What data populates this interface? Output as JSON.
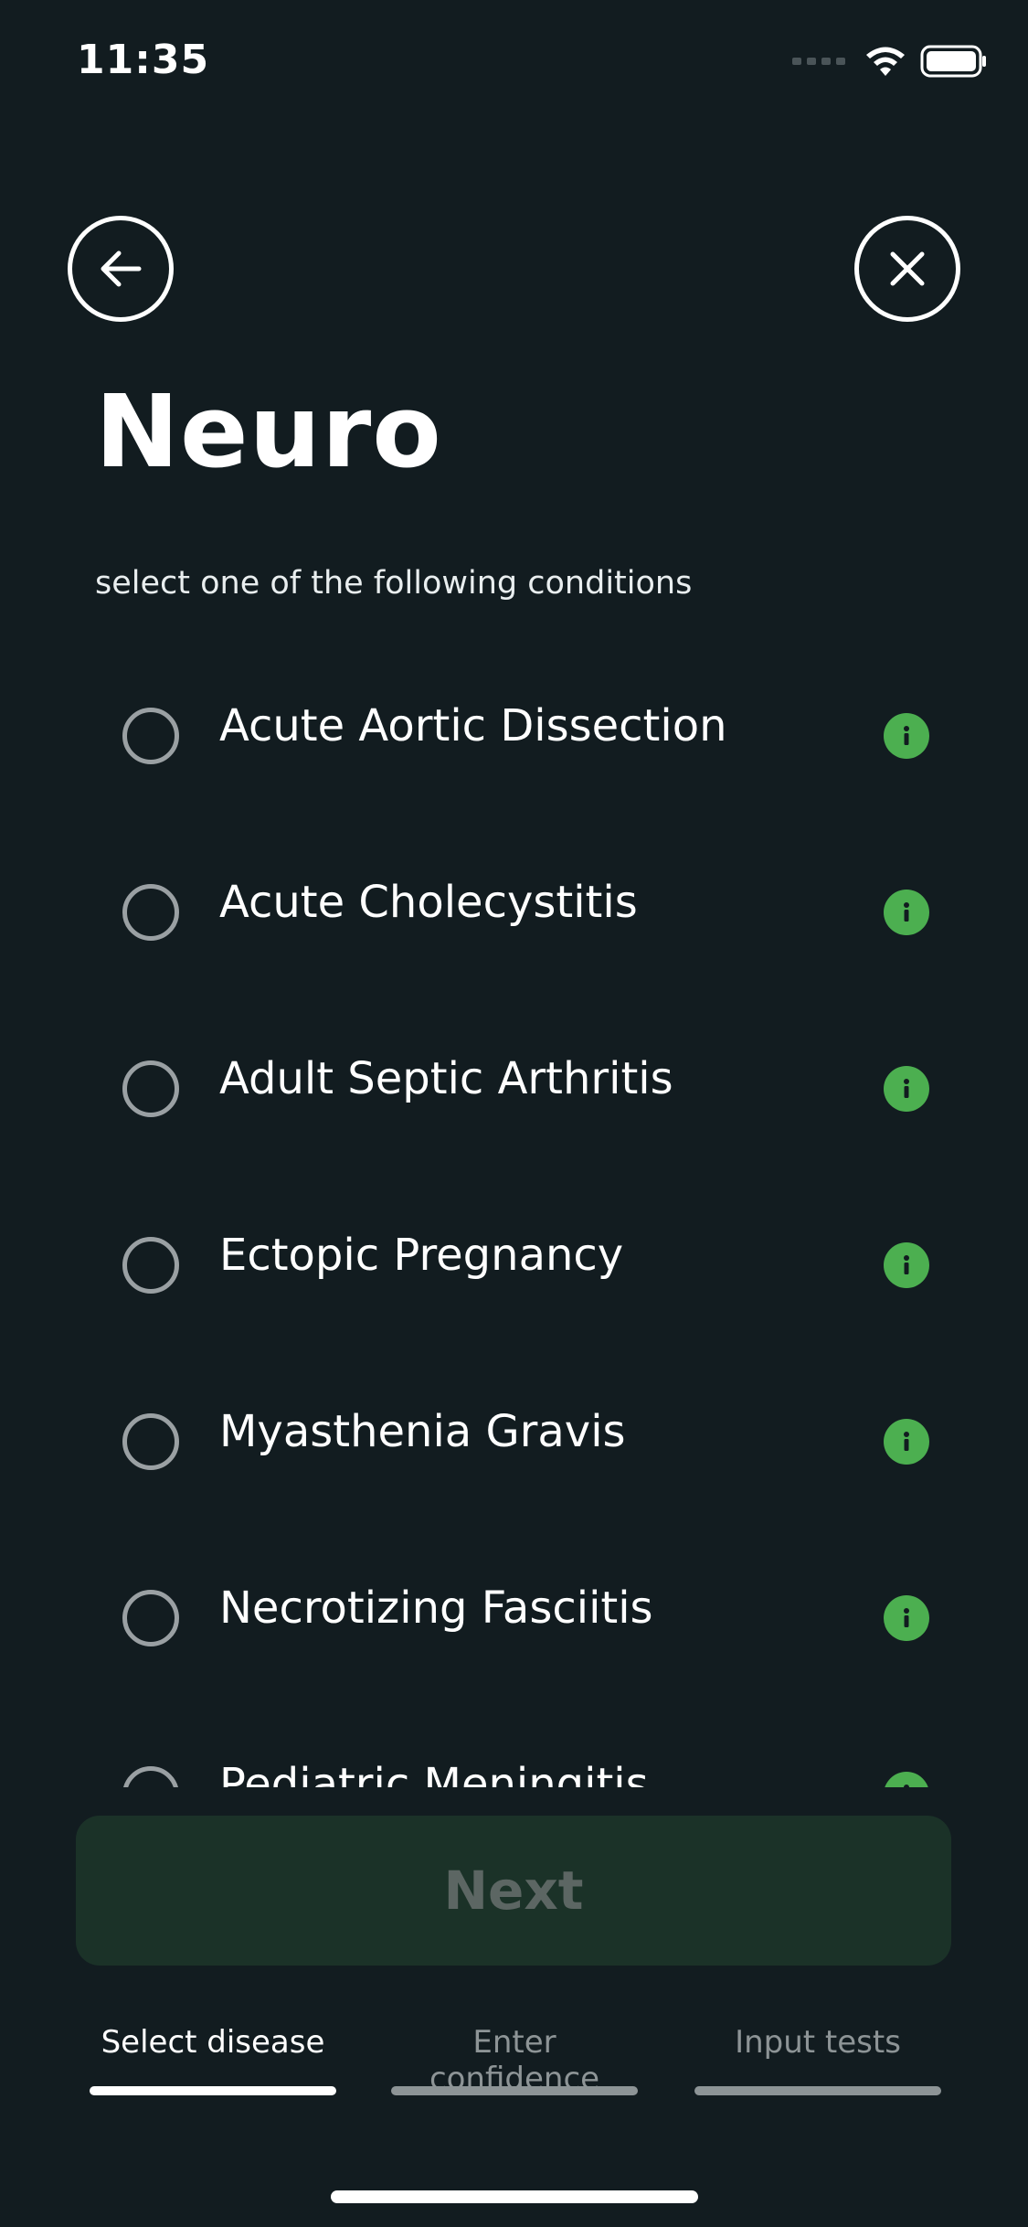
{
  "status_bar": {
    "time": "11:35"
  },
  "header": {
    "title": "Neuro",
    "subtitle": "select one of the following conditions"
  },
  "conditions": [
    {
      "label": "Acute Aortic Dissection"
    },
    {
      "label": "Acute Cholecystitis"
    },
    {
      "label": "Adult Septic Arthritis"
    },
    {
      "label": "Ectopic Pregnancy"
    },
    {
      "label": "Myasthenia Gravis"
    },
    {
      "label": "Necrotizing Fasciitis"
    },
    {
      "label": "Pediatric Meningitis"
    }
  ],
  "footer": {
    "next_label": "Next"
  },
  "steps": [
    {
      "label": "Select disease",
      "active": true
    },
    {
      "label": "Enter confidence",
      "active": false
    },
    {
      "label": "Input tests",
      "active": false
    }
  ],
  "colors": {
    "background": "#121c20",
    "accent_info": "#4caf50",
    "next_button_bg": "#1b3228"
  },
  "icons": {
    "back": "arrow-left-icon",
    "close": "close-icon",
    "info": "info-icon",
    "wifi": "wifi-icon",
    "battery": "battery-icon"
  }
}
